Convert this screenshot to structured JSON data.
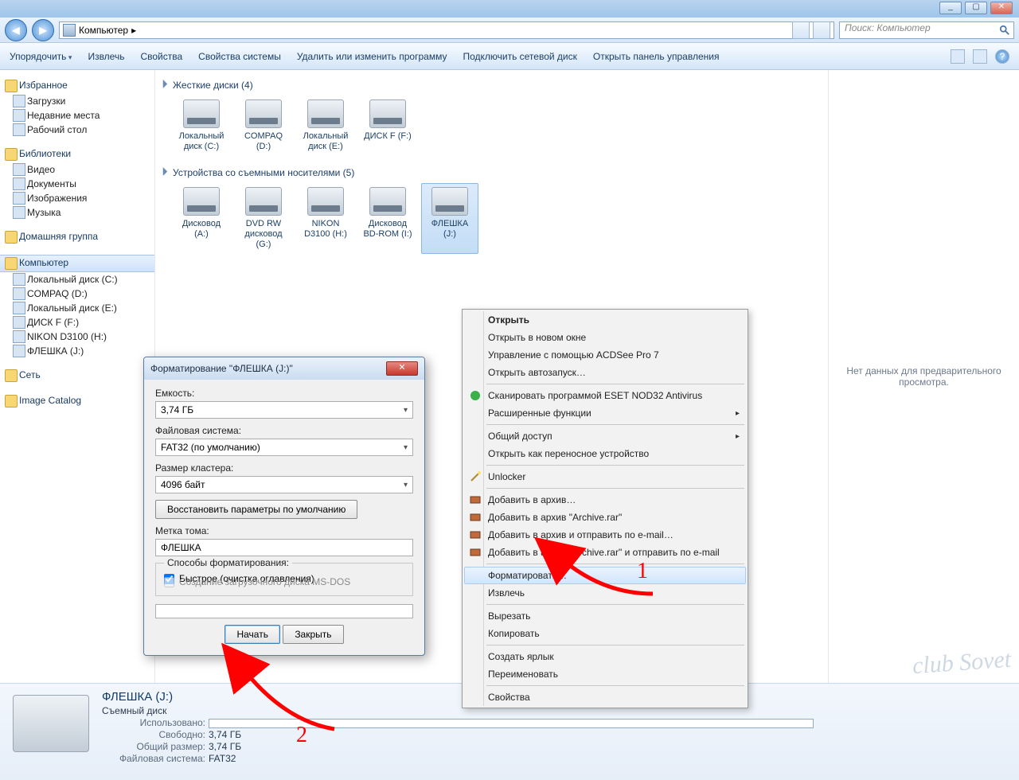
{
  "window": {
    "min": "_",
    "max": "▢",
    "close": "✕"
  },
  "nav": {
    "back": "◀",
    "fwd": "▶",
    "path_root": "Компьютер",
    "path_sep": "▸",
    "search_placeholder": "Поиск: Компьютер"
  },
  "toolbar": {
    "organize": "Упорядочить",
    "eject": "Извлечь",
    "props": "Свойства",
    "sysprops": "Свойства системы",
    "uninstall": "Удалить или изменить программу",
    "netdrive": "Подключить сетевой диск",
    "cpanel": "Открыть панель управления"
  },
  "sidebar": {
    "fav": "Избранное",
    "fav_items": [
      "Загрузки",
      "Недавние места",
      "Рабочий стол"
    ],
    "lib": "Библиотеки",
    "lib_items": [
      "Видео",
      "Документы",
      "Изображения",
      "Музыка"
    ],
    "home": "Домашняя группа",
    "comp": "Компьютер",
    "comp_items": [
      "Локальный диск (C:)",
      "COMPAQ (D:)",
      "Локальный диск (E:)",
      "ДИСК F (F:)",
      "NIKON D3100 (H:)",
      "ФЛЕШКА (J:)"
    ],
    "net": "Сеть",
    "cat": "Image Catalog"
  },
  "groups": {
    "hdd": "Жесткие диски (4)",
    "hdd_drives": [
      {
        "l": "Локальный диск (C:)"
      },
      {
        "l": "COMPAQ (D:)"
      },
      {
        "l": "Локальный диск (E:)"
      },
      {
        "l": "ДИСК F (F:)"
      }
    ],
    "rem": "Устройства со съемными носителями (5)",
    "rem_drives": [
      {
        "l": "Дисковод (A:)"
      },
      {
        "l": "DVD RW дисковод (G:)"
      },
      {
        "l": "NIKON D3100 (H:)"
      },
      {
        "l": "Дисковод BD-ROM (I:)"
      },
      {
        "l": "ФЛЕШКА (J:)",
        "sel": true
      }
    ]
  },
  "preview": "Нет данных для предварительного просмотра.",
  "details": {
    "title": "ФЛЕШКА (J:)",
    "type": "Съемный диск",
    "used_k": "Использовано:",
    "free_k": "Свободно:",
    "free_v": "3,74 ГБ",
    "total_k": "Общий размер:",
    "total_v": "3,74 ГБ",
    "fs_k": "Файловая система:",
    "fs_v": "FAT32"
  },
  "ctx": {
    "open": "Открыть",
    "open_new": "Открыть в новом окне",
    "acdsee": "Управление с помощью ACDSee Pro 7",
    "autorun": "Открыть автозапуск…",
    "eset": "Сканировать программой ESET NOD32 Antivirus",
    "adv": "Расширенные функции",
    "share": "Общий доступ",
    "portable": "Открыть как переносное устройство",
    "unlocker": "Unlocker",
    "rar1": "Добавить в архив…",
    "rar2": "Добавить в архив \"Archive.rar\"",
    "rar3": "Добавить в архив и отправить по e-mail…",
    "rar4": "Добавить в архив \"Archive.rar\" и отправить по e-mail",
    "format": "Форматировать…",
    "eject": "Извлечь",
    "cut": "Вырезать",
    "copy": "Копировать",
    "shortcut": "Создать ярлык",
    "rename": "Переименовать",
    "props": "Свойства"
  },
  "dlg": {
    "title": "Форматирование \"ФЛЕШКА (J:)\"",
    "close": "✕",
    "cap_l": "Емкость:",
    "cap_v": "3,74 ГБ",
    "fs_l": "Файловая система:",
    "fs_v": "FAT32 (по умолчанию)",
    "au_l": "Размер кластера:",
    "au_v": "4096 байт",
    "restore": "Восстановить параметры по умолчанию",
    "vol_l": "Метка тома:",
    "vol_v": "ФЛЕШКА",
    "opts": "Способы форматирования:",
    "quick": "Быстрое (очистка оглавления)",
    "msdos": "Создание загрузочного диска MS-DOS",
    "start": "Начать",
    "cancel": "Закрыть"
  },
  "annot": {
    "one": "1",
    "two": "2"
  },
  "watermark": "club Sovet"
}
